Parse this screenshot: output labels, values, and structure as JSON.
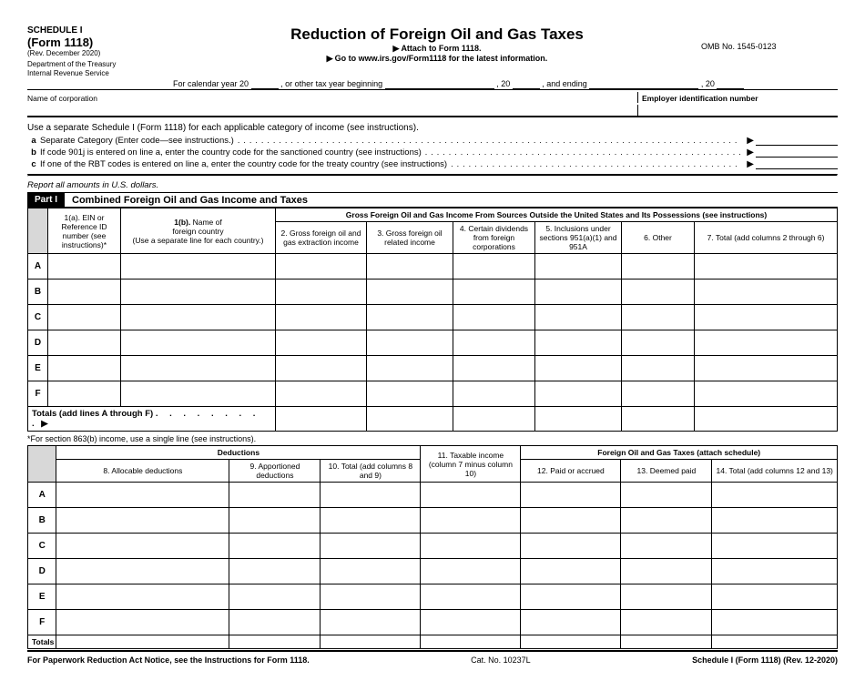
{
  "header": {
    "schedule": "SCHEDULE I",
    "form": "(Form 1118)",
    "rev": "(Rev. December 2020)",
    "dept1": "Department of the Treasury",
    "dept2": "Internal Revenue Service",
    "title": "Reduction of Foreign Oil and Gas Taxes",
    "attach": "Attach to Form 1118.",
    "goto": "Go to www.irs.gov/Form1118 for the latest information.",
    "omb": "OMB No. 1545-0123",
    "yearline": {
      "p1": "For calendar year 20",
      "p2": ", or other tax year beginning",
      "p3": ", 20",
      "p4": ", and ending",
      "p5": ", 20"
    },
    "noc": "Name of corporation",
    "ein": "Employer identification number"
  },
  "instr": "Use a separate Schedule I (Form 1118) for each applicable category of income (see instructions).",
  "lines": {
    "a": "Separate Category (Enter code—see instructions.)",
    "b": "If code 901j is entered on line a, enter the country code for the sanctioned country (see instructions)",
    "c": "If one of the RBT codes is entered on line a, enter the country code for the treaty country (see instructions)"
  },
  "reportit": "Report all amounts in U.S. dollars.",
  "part1": {
    "label": "Part I",
    "title": "Combined Foreign Oil and Gas Income and Taxes"
  },
  "t1headers": {
    "c1a": "1(a). EIN or Reference ID number (see instructions)*",
    "c1b": "1(b). Name of foreign country\n(Use a separate line for each country.)",
    "grosshdr": "Gross Foreign Oil and Gas Income From Sources Outside the United States and Its Possessions (see instructions)",
    "c2": "2. Gross foreign oil and gas extraction income",
    "c3": "3. Gross foreign oil related income",
    "c4": "4. Certain dividends from foreign corporations",
    "c5": "5. Inclusions under sections 951(a)(1) and 951A",
    "c6": "6. Other",
    "c7": "7. Total (add columns 2 through 6)"
  },
  "rows": [
    "A",
    "B",
    "C",
    "D",
    "E",
    "F"
  ],
  "t1totals": {
    "label": "Totals",
    "text": "(add lines A through F)",
    "dots": ". . . . . . . . .",
    "arrow": "▶"
  },
  "note863": "*For section 863(b) income, use a single line (see instructions).",
  "t2headers": {
    "ded": "Deductions",
    "c8": "8. Allocable deductions",
    "c9": "9. Apportioned deductions",
    "c10": "10. Total (add columns 8 and 9)",
    "c11": "11. Taxable income (column 7 minus column 10)",
    "fog": "Foreign Oil and Gas Taxes (attach schedule)",
    "c12": "12. Paid or accrued",
    "c13": "13. Deemed paid",
    "c14": "14. Total (add columns 12 and 13)"
  },
  "t2totals": {
    "label": "Totals"
  },
  "footer": {
    "pra": "For Paperwork Reduction Act Notice, see the Instructions for Form 1118.",
    "cat": "Cat. No. 10237L",
    "sched": "Schedule I (Form 1118) (Rev. 12-2020)"
  }
}
